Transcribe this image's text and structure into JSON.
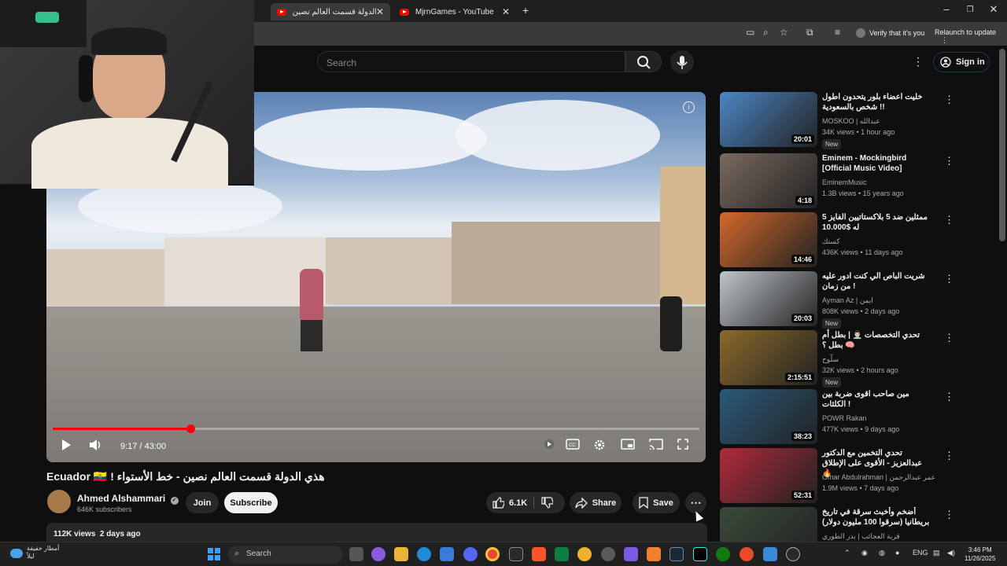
{
  "browser": {
    "tabs": [
      {
        "title": "هذي الدولة قسمت العالم نصين -",
        "active": true
      },
      {
        "title": "MjrnGames - YouTube",
        "active": false
      }
    ],
    "new_tab": "+",
    "verify_label": "Verify that it's you",
    "relaunch_label": "Relaunch to update",
    "window_controls": [
      "–",
      "❐",
      "✕"
    ]
  },
  "youtube": {
    "search_placeholder": "Search",
    "sign_in_label": "Sign in"
  },
  "player": {
    "time_display": "9:17 / 43:00",
    "progress": 0.2128
  },
  "video": {
    "title": "Ecuador 🇪🇨 ! هذي الدولة قسمت العالم نصين - خط الأستواء",
    "channel_name": "Ahmed Alshammari",
    "subscribers": "646K subscribers",
    "join_label": "Join",
    "subscribe_label": "Subscribe",
    "likes": "6.1K",
    "share_label": "Share",
    "save_label": "Save",
    "views_date": "112K views  2 days ago"
  },
  "recommendations": [
    {
      "title": "خليت اعضاء بلور يتحدون اطول شخص بالسعودية !!",
      "channel": "MOSKOO | عبدالله",
      "meta": "34K views • 1 hour ago",
      "badge": "New",
      "duration": "20:01",
      "color": "#4b86c5"
    },
    {
      "title": "Eminem - Mockingbird [Official Music Video]",
      "channel": "EminemMusic",
      "meta": "1.3B views • 15 years ago",
      "badge": "",
      "duration": "4:18",
      "color": "#7a6a60"
    },
    {
      "title": "5 ممثلين ضد 5 بلاكستاتيين الفايز له $10.000",
      "channel": "كستك",
      "meta": "436K views • 11 days ago",
      "badge": "",
      "duration": "14:46",
      "color": "#d4682a"
    },
    {
      "title": "شريت الباص الي كنت ادور عليه من زمان !",
      "channel": "Ayman Az | ايمن",
      "meta": "808K views • 2 days ago",
      "badge": "New",
      "duration": "20:03",
      "color": "#bfc5cb"
    },
    {
      "title": "تحدي التخصصات 👨🏻‍⚕️ | بطل أم بطل ؟ 🧠",
      "channel": "سلّوح",
      "meta": "32K views • 2 hours ago",
      "badge": "New",
      "duration": "2:15:51",
      "color": "#8c6a2a"
    },
    {
      "title": "مين صاحب اقوى ضربة بين الكلثات !",
      "channel": "POWR Rakan",
      "meta": "477K views • 9 days ago",
      "badge": "",
      "duration": "38:23",
      "color": "#2a5a7a"
    },
    {
      "title": "تحدي التخمين مع الدكتور عبدالعزيز - الأقوى على الإطلاق 🔥",
      "channel": "Omar Abdulrahman | عمر عبدالرحمن",
      "meta": "1.9M views • 7 days ago",
      "badge": "",
      "duration": "52:31",
      "color": "#b02a3a"
    },
    {
      "title": "أضخم وأخبث سرقة في تاريخ بريطانيا (سرقوا 100 مليون دولار)",
      "channel": "قرية العجائب | بدر الطوري",
      "meta": "",
      "badge": "",
      "duration": "",
      "color": "#3a4a3a"
    }
  ],
  "taskbar": {
    "weather_line1": "أمطار خفيفة",
    "weather_line2": "ليلاً",
    "search_label": "Search",
    "lang": "ENG",
    "time": "3:46 PM",
    "date": "11/26/2025"
  }
}
